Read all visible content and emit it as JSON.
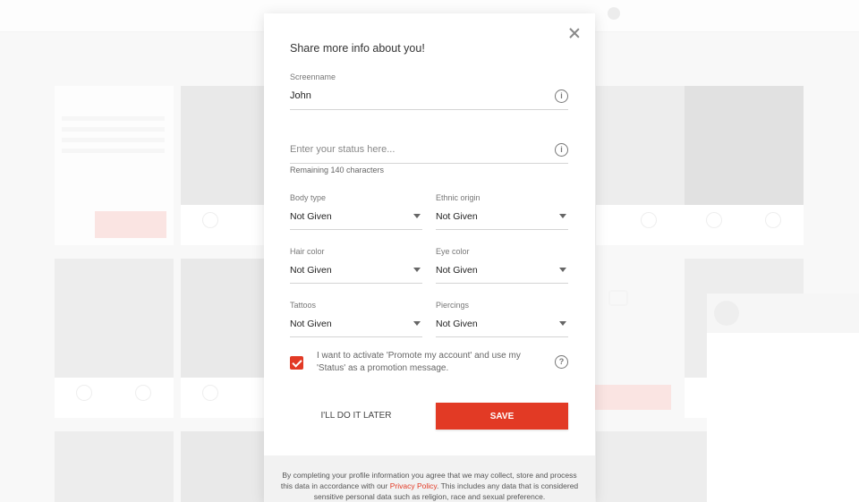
{
  "modal": {
    "title": "Share more info about you!",
    "screenname": {
      "label": "Screenname",
      "value": "John"
    },
    "status": {
      "placeholder": "Enter your status here...",
      "remaining": "Remaining 140 characters"
    },
    "fields": [
      {
        "label": "Body type",
        "value": "Not Given"
      },
      {
        "label": "Ethnic origin",
        "value": "Not Given"
      },
      {
        "label": "Hair color",
        "value": "Not Given"
      },
      {
        "label": "Eye color",
        "value": "Not Given"
      },
      {
        "label": "Tattoos",
        "value": "Not Given"
      },
      {
        "label": "Piercings",
        "value": "Not Given"
      }
    ],
    "promote": {
      "checked": true,
      "text": "I want to activate 'Promote my account' and use my 'Status' as a promotion message."
    },
    "later_label": "I'LL DO IT LATER",
    "save_label": "SAVE",
    "footer": {
      "text_before": "By completing your profile information you agree that we may collect, store and process this data in accordance with our ",
      "link": "Privacy Policy",
      "text_after": ". This includes any data that is considered sensitive personal data such as religion, race and sexual preference."
    },
    "colors": {
      "accent": "#e23a25"
    },
    "icons": {
      "close": "close-icon",
      "info": "info-icon",
      "help": "question-icon",
      "caret": "caret-down-icon",
      "check": "check-icon"
    }
  }
}
